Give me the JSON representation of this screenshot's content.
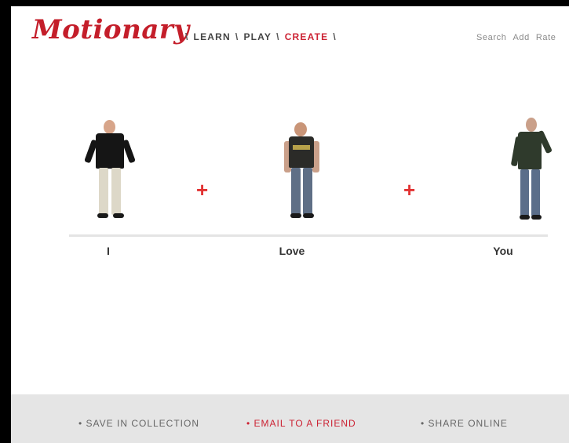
{
  "header": {
    "logo_text": "Motionary",
    "nav": [
      {
        "label": "LEARN"
      },
      {
        "label": "PLAY"
      },
      {
        "label": "CREATE",
        "active": true
      }
    ],
    "separator": "\\",
    "utility_links": [
      "Search",
      "Add",
      "Rate"
    ]
  },
  "sentence": {
    "words": [
      "I",
      "Love",
      "You"
    ],
    "connector_symbol": "+"
  },
  "footer": {
    "actions": [
      {
        "label": "• SAVE IN COLLECTION"
      },
      {
        "label": "• EMAIL TO A FRIEND",
        "highlight": true
      },
      {
        "label": "• SHARE ONLINE"
      }
    ]
  },
  "colors": {
    "brand_red": "#c41e2a",
    "accent_red": "#cc2233",
    "plus_red": "#e23333",
    "footer_bg": "#e5e5e5"
  }
}
